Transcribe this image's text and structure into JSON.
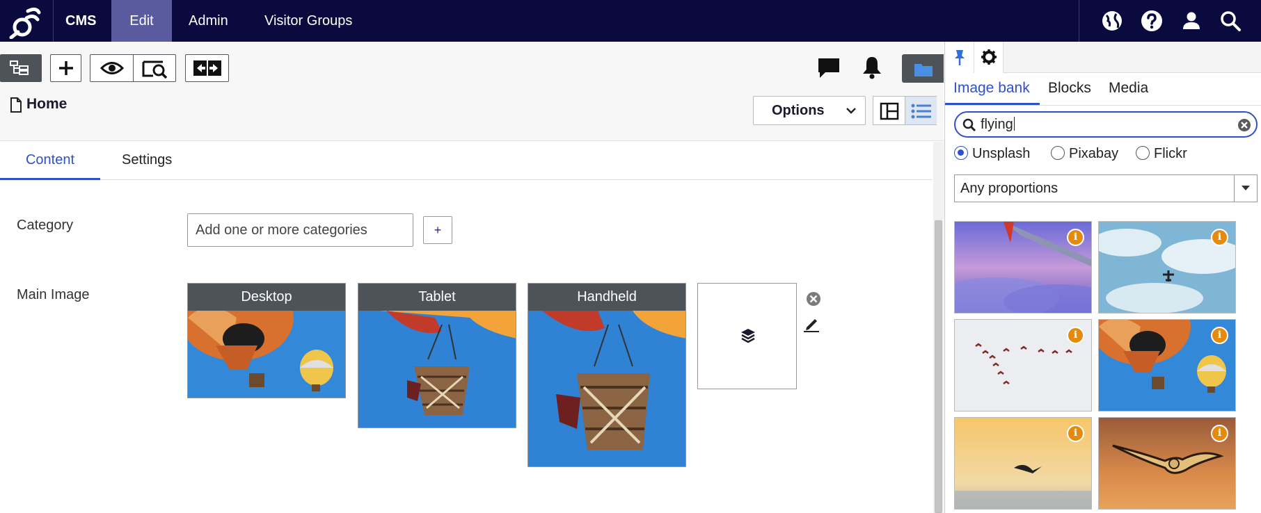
{
  "nav": {
    "items": [
      "CMS",
      "Edit",
      "Admin",
      "Visitor Groups"
    ],
    "active": "Edit",
    "right_icons": [
      "globe-icon",
      "help-icon",
      "user-icon",
      "search-icon"
    ]
  },
  "toolbar": {
    "buttons": [
      "page-tree-icon",
      "add-icon",
      "preview-icon",
      "view-on-site-icon",
      "compare-icon"
    ],
    "page_title": "Home",
    "options_label": "Options",
    "right_icons": [
      "comments-icon",
      "notifications-icon",
      "assets-folder-icon"
    ]
  },
  "tabs": {
    "content": "Content",
    "settings": "Settings",
    "active": "Content"
  },
  "form": {
    "category_label": "Category",
    "category_placeholder": "Add one or more categories",
    "category_add": "+",
    "main_image_label": "Main Image",
    "renditions": [
      {
        "label": "Desktop"
      },
      {
        "label": "Tablet"
      },
      {
        "label": "Handheld"
      }
    ]
  },
  "panel": {
    "tabs": [
      "Image bank",
      "Blocks",
      "Media"
    ],
    "active_tab": "Image bank",
    "search_value": "flying",
    "sources": [
      "Unsplash",
      "Pixabay",
      "Flickr"
    ],
    "selected_source": "Unsplash",
    "proportions": "Any proportions",
    "results": [
      {
        "subject": "airplane wing above clouds"
      },
      {
        "subject": "airplane in cloudy sky"
      },
      {
        "subject": "flock of birds"
      },
      {
        "subject": "hot air balloons"
      },
      {
        "subject": "bird at sunset over sea"
      },
      {
        "subject": "owl in flight"
      }
    ],
    "info_glyph": "i"
  },
  "colors": {
    "nav_bg": "#0b0a3f",
    "accent": "#2f50c9",
    "info_badge": "#e58a0d",
    "dark_button": "#4d5358"
  }
}
